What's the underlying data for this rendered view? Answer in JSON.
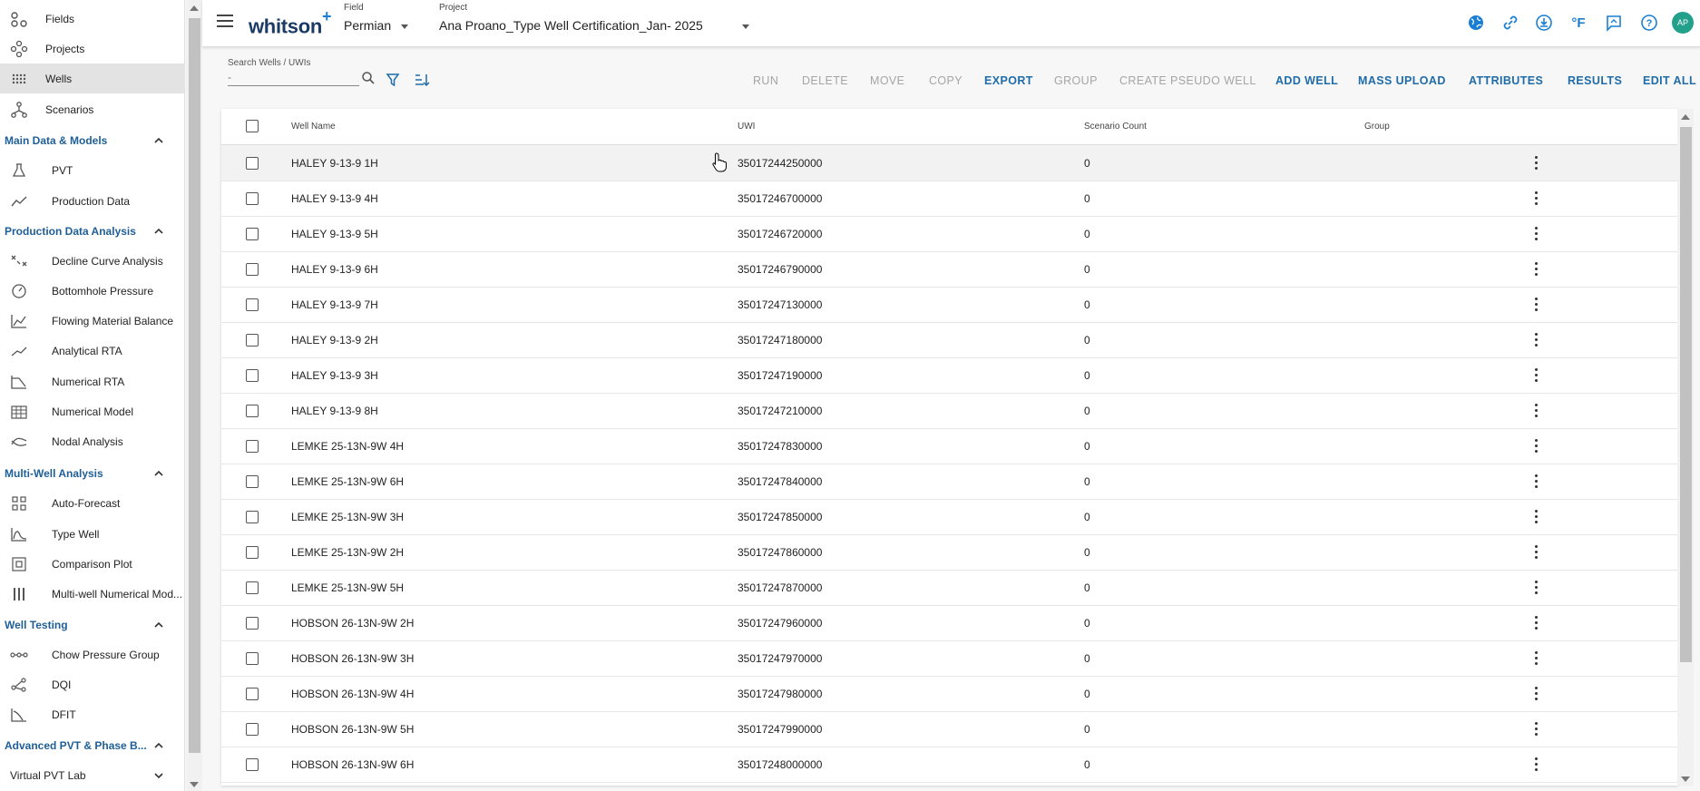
{
  "sidebar": {
    "top_items": [
      {
        "label": "Fields",
        "icon": "fields-icon"
      },
      {
        "label": "Projects",
        "icon": "projects-icon"
      },
      {
        "label": "Wells",
        "icon": "wells-icon",
        "active": true
      },
      {
        "label": "Scenarios",
        "icon": "scenarios-icon"
      }
    ],
    "sections": [
      {
        "title": "Main Data & Models",
        "items": [
          {
            "label": "PVT",
            "icon": "flask-icon"
          },
          {
            "label": "Production Data",
            "icon": "trend-icon"
          }
        ]
      },
      {
        "title": "Production Data Analysis",
        "items": [
          {
            "label": "Decline Curve Analysis",
            "icon": "decline-icon"
          },
          {
            "label": "Bottomhole Pressure",
            "icon": "gauge-icon"
          },
          {
            "label": "Flowing Material Balance",
            "icon": "fmb-chart-icon"
          },
          {
            "label": "Analytical RTA",
            "icon": "rta-line-icon"
          },
          {
            "label": "Numerical RTA",
            "icon": "numerical-rta-icon"
          },
          {
            "label": "Numerical Model",
            "icon": "grid-model-icon"
          },
          {
            "label": "Nodal Analysis",
            "icon": "nodal-icon"
          }
        ]
      },
      {
        "title": "Multi-Well Analysis",
        "items": [
          {
            "label": "Auto-Forecast",
            "icon": "auto-forecast-icon"
          },
          {
            "label": "Type Well",
            "icon": "type-well-icon"
          },
          {
            "label": "Comparison Plot",
            "icon": "comparison-icon"
          },
          {
            "label": "Multi-well Numerical Mod...",
            "icon": "multiwell-icon"
          }
        ]
      },
      {
        "title": "Well Testing",
        "items": [
          {
            "label": "Chow Pressure Group",
            "icon": "chow-icon"
          },
          {
            "label": "DQI",
            "icon": "dqi-icon"
          },
          {
            "label": "DFIT",
            "icon": "dfit-icon"
          }
        ]
      },
      {
        "title": "Advanced PVT & Phase B...",
        "items": []
      }
    ],
    "sub_group": "Virtual PVT Lab"
  },
  "header": {
    "logo": "whitson",
    "logo_plus": "+",
    "field_label": "Field",
    "field_value": "Permian",
    "project_label": "Project",
    "project_value": "Ana Proano_Type Well Certification_Jan- 2025",
    "avatar": "AP",
    "icons": [
      "globe-icon",
      "link-icon",
      "download-icon",
      "fahrenheit-icon",
      "feedback-icon",
      "help-icon"
    ]
  },
  "toolbar": {
    "search_label": "Search Wells / UWIs",
    "search_placeholder": "-",
    "actions_disabled": [
      "RUN",
      "DELETE",
      "MOVE",
      "COPY"
    ],
    "export": "EXPORT",
    "group": "GROUP",
    "create_pseudo": "CREATE PSEUDO WELL",
    "add_well": "ADD WELL",
    "mass_upload": "MASS UPLOAD",
    "attributes": "ATTRIBUTES",
    "results": "RESULTS",
    "edit_all": "EDIT ALL"
  },
  "table": {
    "columns": {
      "name": "Well Name",
      "uwi": "UWI",
      "scenario_count": "Scenario Count",
      "group": "Group"
    },
    "rows": [
      {
        "name": "HALEY 9-13-9 1H",
        "uwi": "35017244250000",
        "count": "0"
      },
      {
        "name": "HALEY 9-13-9 4H",
        "uwi": "35017246700000",
        "count": "0"
      },
      {
        "name": "HALEY 9-13-9 5H",
        "uwi": "35017246720000",
        "count": "0"
      },
      {
        "name": "HALEY 9-13-9 6H",
        "uwi": "35017246790000",
        "count": "0"
      },
      {
        "name": "HALEY 9-13-9 7H",
        "uwi": "35017247130000",
        "count": "0"
      },
      {
        "name": "HALEY 9-13-9 2H",
        "uwi": "35017247180000",
        "count": "0"
      },
      {
        "name": "HALEY 9-13-9 3H",
        "uwi": "35017247190000",
        "count": "0"
      },
      {
        "name": "HALEY 9-13-9 8H",
        "uwi": "35017247210000",
        "count": "0"
      },
      {
        "name": "LEMKE 25-13N-9W 4H",
        "uwi": "35017247830000",
        "count": "0"
      },
      {
        "name": "LEMKE 25-13N-9W 6H",
        "uwi": "35017247840000",
        "count": "0"
      },
      {
        "name": "LEMKE 25-13N-9W 3H",
        "uwi": "35017247850000",
        "count": "0"
      },
      {
        "name": "LEMKE 25-13N-9W 2H",
        "uwi": "35017247860000",
        "count": "0"
      },
      {
        "name": "LEMKE 25-13N-9W 5H",
        "uwi": "35017247870000",
        "count": "0"
      },
      {
        "name": "HOBSON 26-13N-9W 2H",
        "uwi": "35017247960000",
        "count": "0"
      },
      {
        "name": "HOBSON 26-13N-9W 3H",
        "uwi": "35017247970000",
        "count": "0"
      },
      {
        "name": "HOBSON 26-13N-9W 4H",
        "uwi": "35017247980000",
        "count": "0"
      },
      {
        "name": "HOBSON 26-13N-9W 5H",
        "uwi": "35017247990000",
        "count": "0"
      },
      {
        "name": "HOBSON 26-13N-9W 6H",
        "uwi": "35017248000000",
        "count": "0"
      }
    ]
  },
  "colors": {
    "accent": "#1f6ca8",
    "section": "#1f5f97",
    "avatar": "#22a08c"
  }
}
